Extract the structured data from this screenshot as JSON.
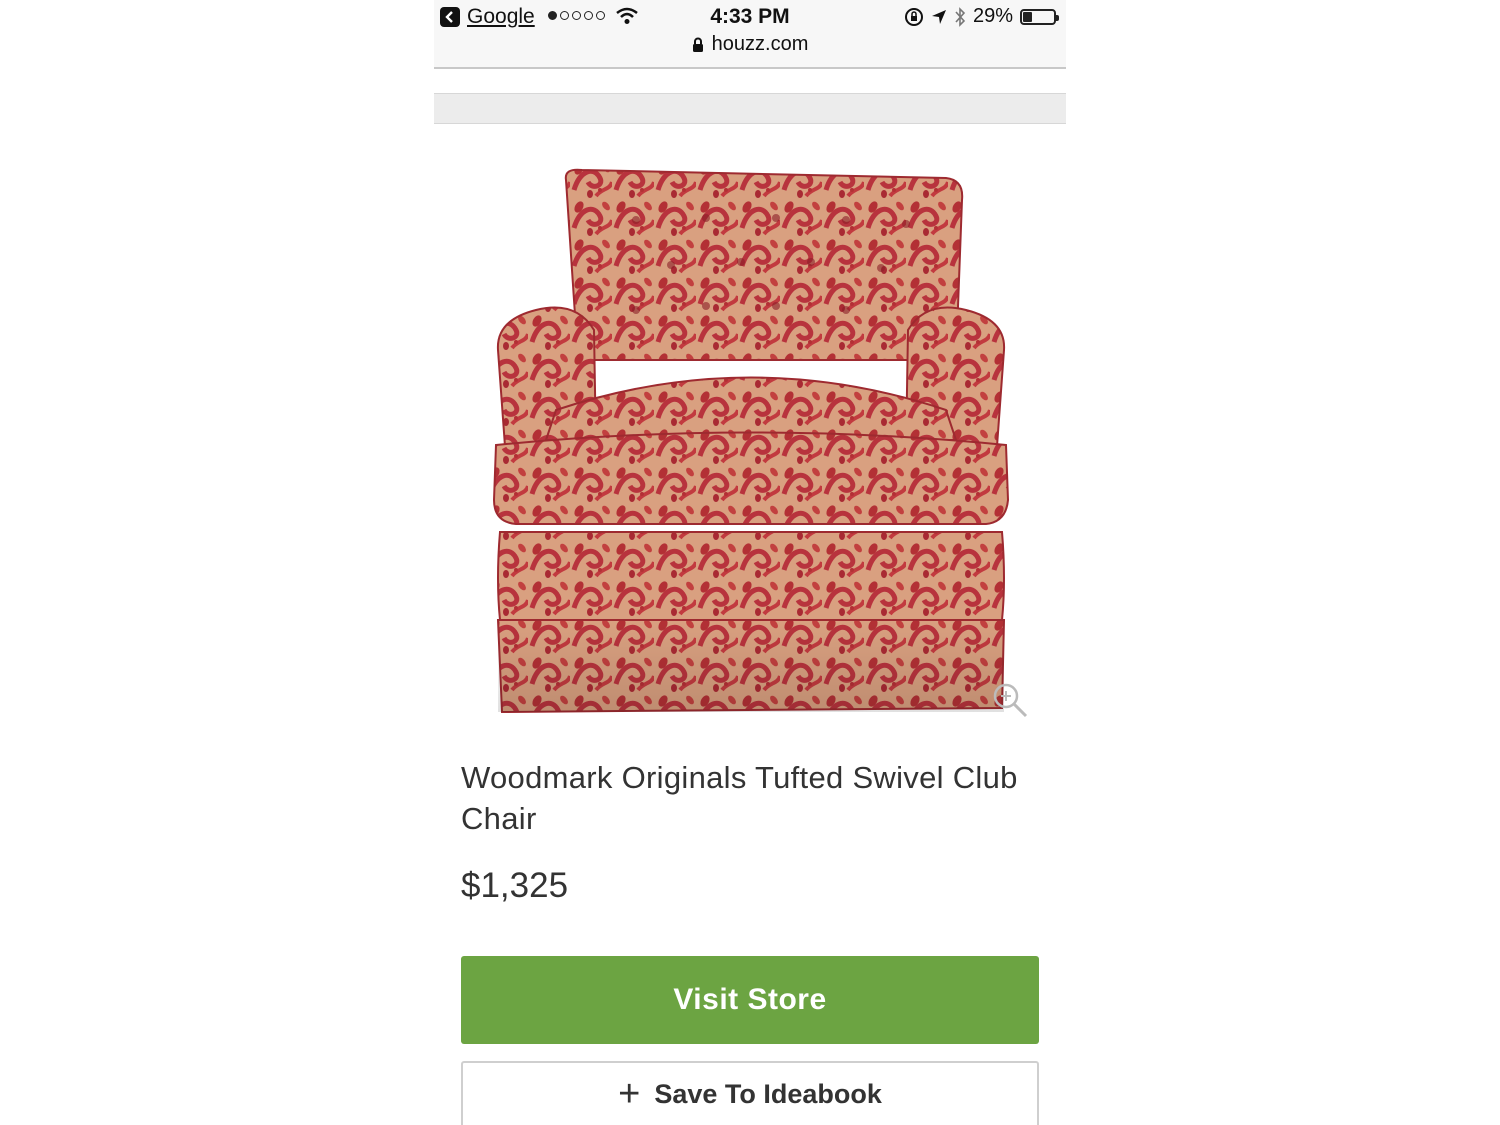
{
  "status_bar": {
    "back_app": "Google",
    "time": "4:33 PM",
    "battery": "29%",
    "battery_level": 0.29,
    "url": "houzz.com"
  },
  "product": {
    "title": "Woodmark Originals Tufted Swivel Club Chair",
    "price": "$1,325"
  },
  "actions": {
    "visit_store": "Visit Store",
    "save_ideabook": "Save To Ideabook"
  },
  "colors": {
    "primary_green": "#6ca442",
    "text": "#333333"
  }
}
